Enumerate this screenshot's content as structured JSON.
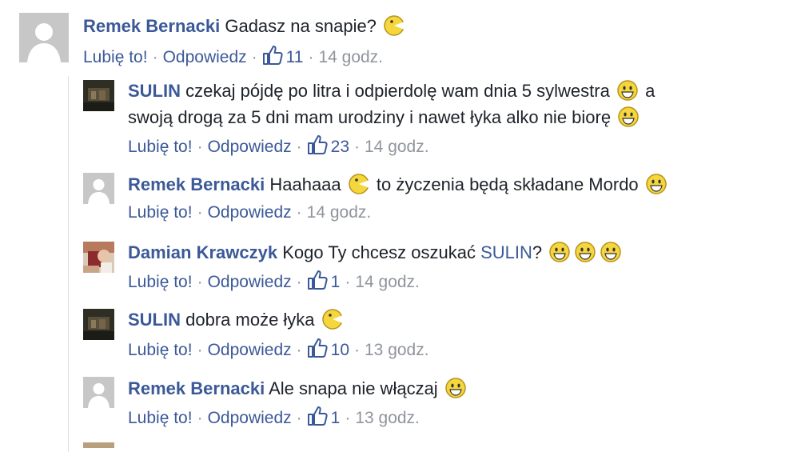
{
  "comments": [
    {
      "author": "Remek Bernacki",
      "text_parts": [
        "Gadasz na snapie?"
      ],
      "emojis": [
        "pacman-smiley"
      ],
      "like_label": "Lubię to!",
      "reply_label": "Odpowiedz",
      "likes": "11",
      "time": "14 godz."
    },
    {
      "author": "SULIN",
      "line1": "czekaj pójdę po litra i odpierdolę wam dnia 5 sylwestra",
      "line1_end": "a",
      "line2": "swoją drogą za 5 dni mam urodziny i nawet łyka alko nie biorę",
      "like_label": "Lubię to!",
      "reply_label": "Odpowiedz",
      "likes": "23",
      "time": "14 godz."
    },
    {
      "author": "Remek Bernacki",
      "text_a": "Haahaaa",
      "text_b": "to życzenia będą składane Mordo",
      "like_label": "Lubię to!",
      "reply_label": "Odpowiedz",
      "time": "14 godz."
    },
    {
      "author": "Damian Krawczyk",
      "text_a": "Kogo Ty chcesz oszukać",
      "mention": "SULIN",
      "text_b": "?",
      "like_label": "Lubię to!",
      "reply_label": "Odpowiedz",
      "likes": "1",
      "time": "14 godz."
    },
    {
      "author": "SULIN",
      "text_a": "dobra może łyka",
      "like_label": "Lubię to!",
      "reply_label": "Odpowiedz",
      "likes": "10",
      "time": "13 godz."
    },
    {
      "author": "Remek Bernacki",
      "text_a": "Ale snapa nie włączaj",
      "like_label": "Lubię to!",
      "reply_label": "Odpowiedz",
      "likes": "1",
      "time": "13 godz."
    }
  ],
  "colors": {
    "link": "#3b5998",
    "meta": "#90949c",
    "text": "#1d2129",
    "emoji": "#f5d63d"
  }
}
